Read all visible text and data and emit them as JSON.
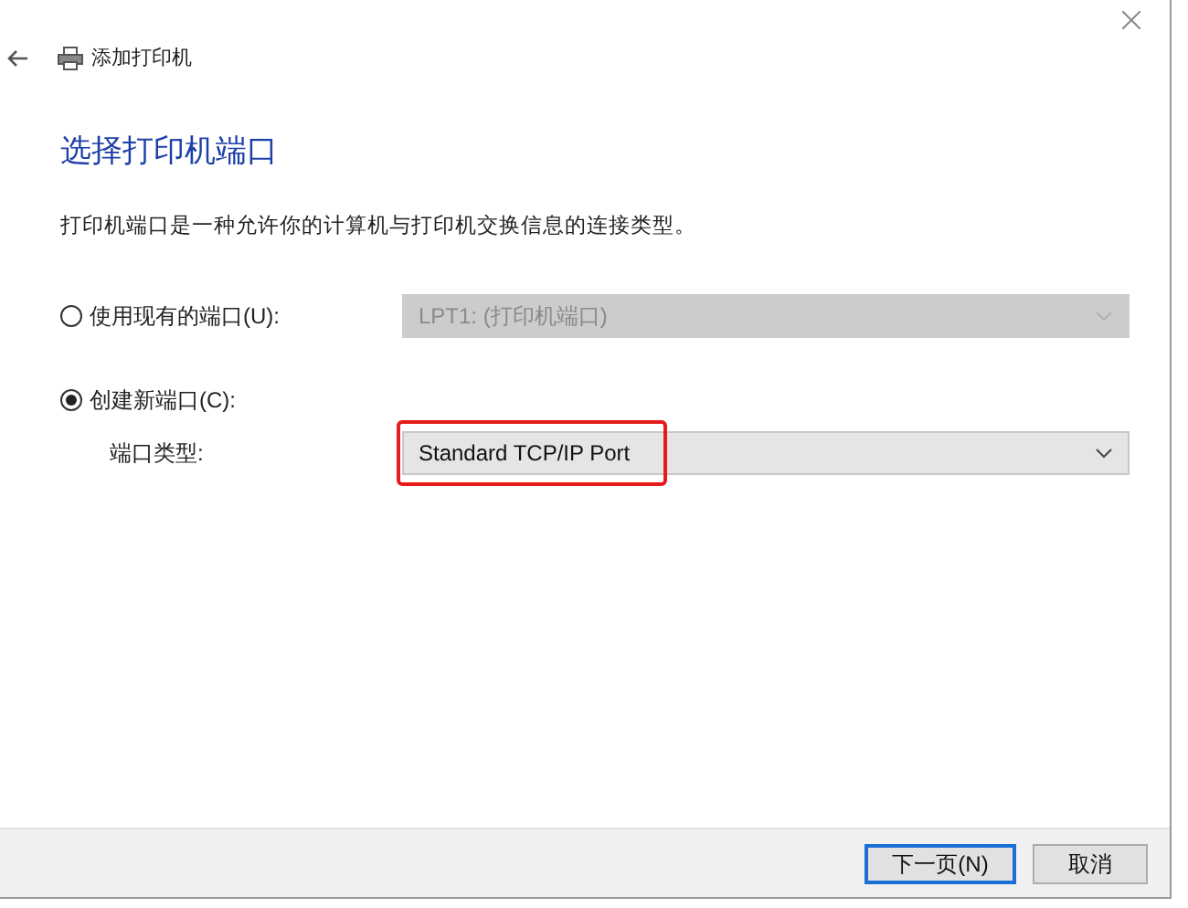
{
  "window": {
    "title": "添加打印机"
  },
  "heading": "选择打印机端口",
  "description": "打印机端口是一种允许你的计算机与打印机交换信息的连接类型。",
  "options": [
    {
      "label": "使用现有的端口(U):",
      "selected": false,
      "dropdown": {
        "value": "LPT1: (打印机端口)",
        "disabled": true
      }
    },
    {
      "label": "创建新端口(C):",
      "selected": true
    }
  ],
  "port_type": {
    "label": "端口类型:",
    "dropdown": {
      "value": "Standard TCP/IP Port",
      "disabled": false,
      "highlighted": true
    }
  },
  "buttons": [
    {
      "label": "下一页(N)",
      "default": true
    },
    {
      "label": "取消",
      "default": false
    }
  ]
}
